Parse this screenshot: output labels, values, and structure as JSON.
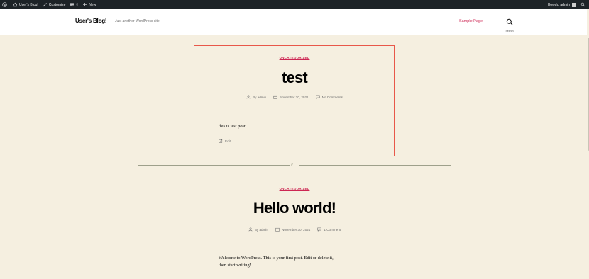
{
  "admin_bar": {
    "site_name": "User's Blog!",
    "customize": "Customize",
    "comments_count": "0",
    "new": "New",
    "howdy": "Howdy, admin"
  },
  "header": {
    "site_title": "User's Blog!",
    "site_description": "Just another WordPress site",
    "menu_item": "Sample Page",
    "search_label": "Search"
  },
  "posts": [
    {
      "category": "UNCATEGORIZED",
      "title": "test",
      "author": "By admin",
      "date": "November 30, 2021",
      "comments": "No Comments",
      "content": "this is test post",
      "edit": "Edit"
    },
    {
      "category": "UNCATEGORIZED",
      "title": "Hello world!",
      "author": "By admin",
      "date": "November 30, 2021",
      "comments": "1 Comment",
      "content_line1": "Welcome to WordPress. This is your first post. Edit or delete it,",
      "content_line2": "then start writing!"
    }
  ],
  "separator": "//",
  "colors": {
    "accent": "#cd2653",
    "background": "#f5efe0",
    "highlight": "#e8584a",
    "admin_bar": "#1d2327"
  }
}
